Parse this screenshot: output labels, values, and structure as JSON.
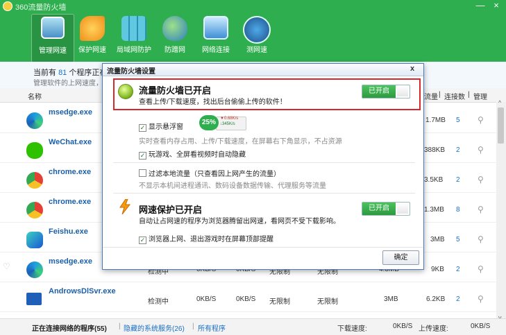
{
  "window": {
    "title": "360流量防火墙",
    "minimize": "—",
    "close": "×"
  },
  "toolbar": {
    "items": [
      {
        "label": "管理网速"
      },
      {
        "label": "保护网速"
      },
      {
        "label": "局域网防护"
      },
      {
        "label": "防蹭网"
      },
      {
        "label": "网络连接"
      },
      {
        "label": "测网速"
      }
    ]
  },
  "info": {
    "count_prefix": "当前有",
    "count": "81",
    "count_suffix": "个程序正在",
    "subtitle": "管理软件的上网速度，"
  },
  "columns": {
    "name": "名称",
    "upload_total": "流量",
    "connections": "连接数",
    "manage": "管理"
  },
  "rows": [
    {
      "name": "msedge.exe",
      "flow": "1.7MB",
      "conns": "5"
    },
    {
      "name": "WeChat.exe",
      "flow": "388KB",
      "conns": "2"
    },
    {
      "name": "chrome.exe",
      "flow": "3.5KB",
      "conns": "2"
    },
    {
      "name": "chrome.exe",
      "flow": "1.3MB",
      "conns": "8"
    },
    {
      "name": "Feishu.exe",
      "flow": "3MB",
      "conns": "5"
    },
    {
      "name": "msedge.exe",
      "status": "检测中",
      "down": "0KB/S",
      "up": "0KB/S",
      "dlimit": "无限制",
      "ulimit": "无限制",
      "total": "4.3MB",
      "flow": "9KB",
      "conns": "2"
    },
    {
      "name": "AndrowsDlSvr.exe",
      "status": "检测中",
      "down": "0KB/S",
      "up": "0KB/S",
      "dlimit": "无限制",
      "ulimit": "无限制",
      "total": "3MB",
      "flow": "6.2KB",
      "conns": "2"
    }
  ],
  "bottom": {
    "tab_connected": "正在连接网络的程序(55)",
    "tab_hidden": "隐藏的系统服务(26)",
    "tab_all": "所有程序",
    "down_label": "下载速度:",
    "down_value": "0KB/S",
    "up_label": "上传速度:",
    "up_value": "0KB/S"
  },
  "dialog": {
    "title": "流量防火墙设置",
    "close": "x",
    "firewall_title": "流量防火墙已开启",
    "firewall_sub": "查看上传/下载速度，找出后台偷偷上传的软件！",
    "toggle_on": "已开启",
    "show_float": "显示悬浮窗",
    "gauge_pct": "25%",
    "gauge_up": "0.68K/s",
    "gauge_down": "345K/s",
    "float_desc": "实时查看内存占用、上传/下载速度，在屏幕右下角显示，不占资源",
    "auto_hide": "玩游戏、全屏看视频时自动隐藏",
    "filter_local": "过滤本地流量（只查看因上网产生的流量）",
    "filter_desc": "不显示本机间进程通讯、数码设备数据传输、代理服务等流量",
    "protect_title": "网速保护已开启",
    "protect_sub": "自动让占网速的程序为浏览器腾留出网速，看网页不受下载影响。",
    "protect_toggle": "已开启",
    "browser_remind": "浏览器上网、退出游戏时在屏幕顶部提醒",
    "ok": "确定"
  },
  "colors": {
    "brand_green": "#2fae4f",
    "link_blue": "#1a6fc4",
    "highlight_red": "#d9262b"
  }
}
